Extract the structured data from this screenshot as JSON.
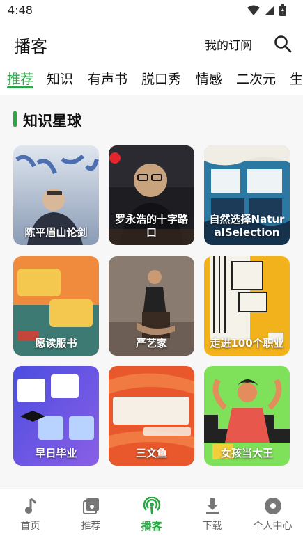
{
  "status": {
    "time": "4:48"
  },
  "header": {
    "title": "播客",
    "subscribe_label": "我的订阅"
  },
  "tabs": [
    {
      "label": "推荐",
      "active": true
    },
    {
      "label": "知识",
      "active": false
    },
    {
      "label": "有声书",
      "active": false
    },
    {
      "label": "脱口秀",
      "active": false
    },
    {
      "label": "情感",
      "active": false
    },
    {
      "label": "二次元",
      "active": false
    },
    {
      "label": "生",
      "active": false
    }
  ],
  "section": {
    "title": "知识星球"
  },
  "cards": [
    {
      "label": "陈平眉山论剑"
    },
    {
      "label": "罗永浩的十字路口"
    },
    {
      "label": "自然选择NaturalSelection"
    },
    {
      "label": "愿读服书"
    },
    {
      "label": "严艺家"
    },
    {
      "label": "走进100个职业"
    },
    {
      "label": "早日毕业"
    },
    {
      "label": "三文鱼"
    },
    {
      "label": "女孩当大王"
    }
  ],
  "nav": [
    {
      "label": "首页",
      "icon": "music-note-icon",
      "active": false
    },
    {
      "label": "推荐",
      "icon": "album-icon",
      "active": false
    },
    {
      "label": "播客",
      "icon": "podcast-icon",
      "active": true
    },
    {
      "label": "下载",
      "icon": "download-icon",
      "active": false
    },
    {
      "label": "个人中心",
      "icon": "disc-icon",
      "active": false
    }
  ],
  "colors": {
    "accent": "#2aa745",
    "background": "#f7f7f7"
  }
}
